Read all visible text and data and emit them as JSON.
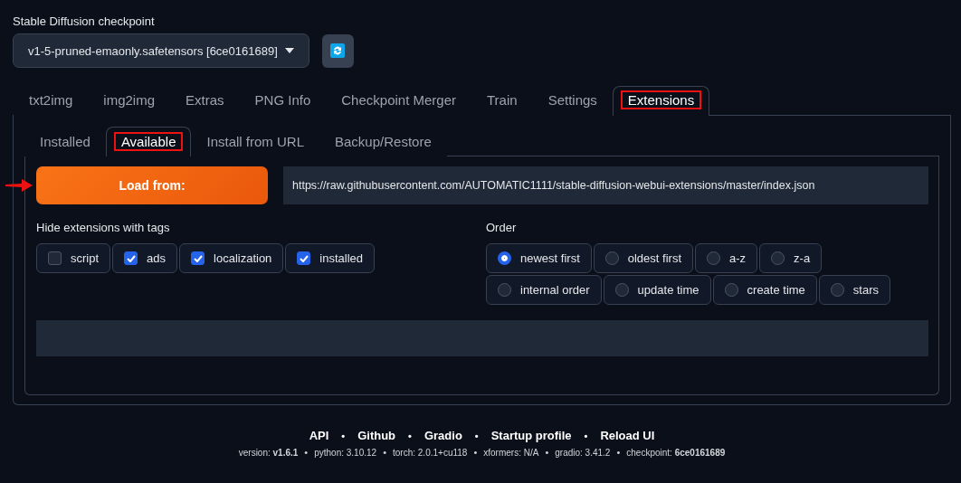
{
  "checkpoint": {
    "label": "Stable Diffusion checkpoint",
    "value": "v1-5-pruned-emaonly.safetensors [6ce0161689]"
  },
  "tabs": [
    {
      "label": "txt2img",
      "selected": false,
      "highlighted": false
    },
    {
      "label": "img2img",
      "selected": false,
      "highlighted": false
    },
    {
      "label": "Extras",
      "selected": false,
      "highlighted": false
    },
    {
      "label": "PNG Info",
      "selected": false,
      "highlighted": false
    },
    {
      "label": "Checkpoint Merger",
      "selected": false,
      "highlighted": false
    },
    {
      "label": "Train",
      "selected": false,
      "highlighted": false
    },
    {
      "label": "Settings",
      "selected": false,
      "highlighted": false
    },
    {
      "label": "Extensions",
      "selected": true,
      "highlighted": true
    }
  ],
  "subtabs": [
    {
      "label": "Installed",
      "selected": false,
      "highlighted": false
    },
    {
      "label": "Available",
      "selected": true,
      "highlighted": true
    },
    {
      "label": "Install from URL",
      "selected": false,
      "highlighted": false
    },
    {
      "label": "Backup/Restore",
      "selected": false,
      "highlighted": false
    }
  ],
  "load_from": {
    "label": "Load from:",
    "pointer_arrow": true,
    "url": "https://raw.githubusercontent.com/AUTOMATIC1111/stable-diffusion-webui-extensions/master/index.json"
  },
  "hide_tags": {
    "label": "Hide extensions with tags",
    "options": [
      {
        "label": "script",
        "checked": false
      },
      {
        "label": "ads",
        "checked": true
      },
      {
        "label": "localization",
        "checked": true
      },
      {
        "label": "installed",
        "checked": true
      }
    ]
  },
  "order": {
    "label": "Order",
    "options": [
      {
        "label": "newest first",
        "selected": true
      },
      {
        "label": "oldest first",
        "selected": false
      },
      {
        "label": "a-z",
        "selected": false
      },
      {
        "label": "z-a",
        "selected": false
      },
      {
        "label": "internal order",
        "selected": false
      },
      {
        "label": "update time",
        "selected": false
      },
      {
        "label": "create time",
        "selected": false
      },
      {
        "label": "stars",
        "selected": false
      }
    ]
  },
  "footer": {
    "links": [
      {
        "kind": "link",
        "text": "API"
      },
      {
        "kind": "separator",
        "text": "•"
      },
      {
        "kind": "link",
        "text": "Github"
      },
      {
        "kind": "separator",
        "text": "•"
      },
      {
        "kind": "link",
        "text": "Gradio"
      },
      {
        "kind": "separator",
        "text": "•"
      },
      {
        "kind": "link",
        "text": "Startup profile"
      },
      {
        "kind": "separator",
        "text": "•"
      },
      {
        "kind": "link",
        "text": "Reload UI"
      }
    ],
    "versions": [
      {
        "kind": "info",
        "text": "version: **v1.6.1**"
      },
      {
        "kind": "separator",
        "text": "•"
      },
      {
        "kind": "info",
        "text": "python: 3.10.12"
      },
      {
        "kind": "separator",
        "text": "•"
      },
      {
        "kind": "info",
        "text": "torch: 2.0.1+cu118"
      },
      {
        "kind": "separator",
        "text": "•"
      },
      {
        "kind": "info",
        "text": "xformers: N/A"
      },
      {
        "kind": "separator",
        "text": "•"
      },
      {
        "kind": "info",
        "text": "gradio: 3.41.2"
      },
      {
        "kind": "separator",
        "text": "•"
      },
      {
        "kind": "info",
        "text": "checkpoint: **6ce0161689**"
      }
    ]
  }
}
